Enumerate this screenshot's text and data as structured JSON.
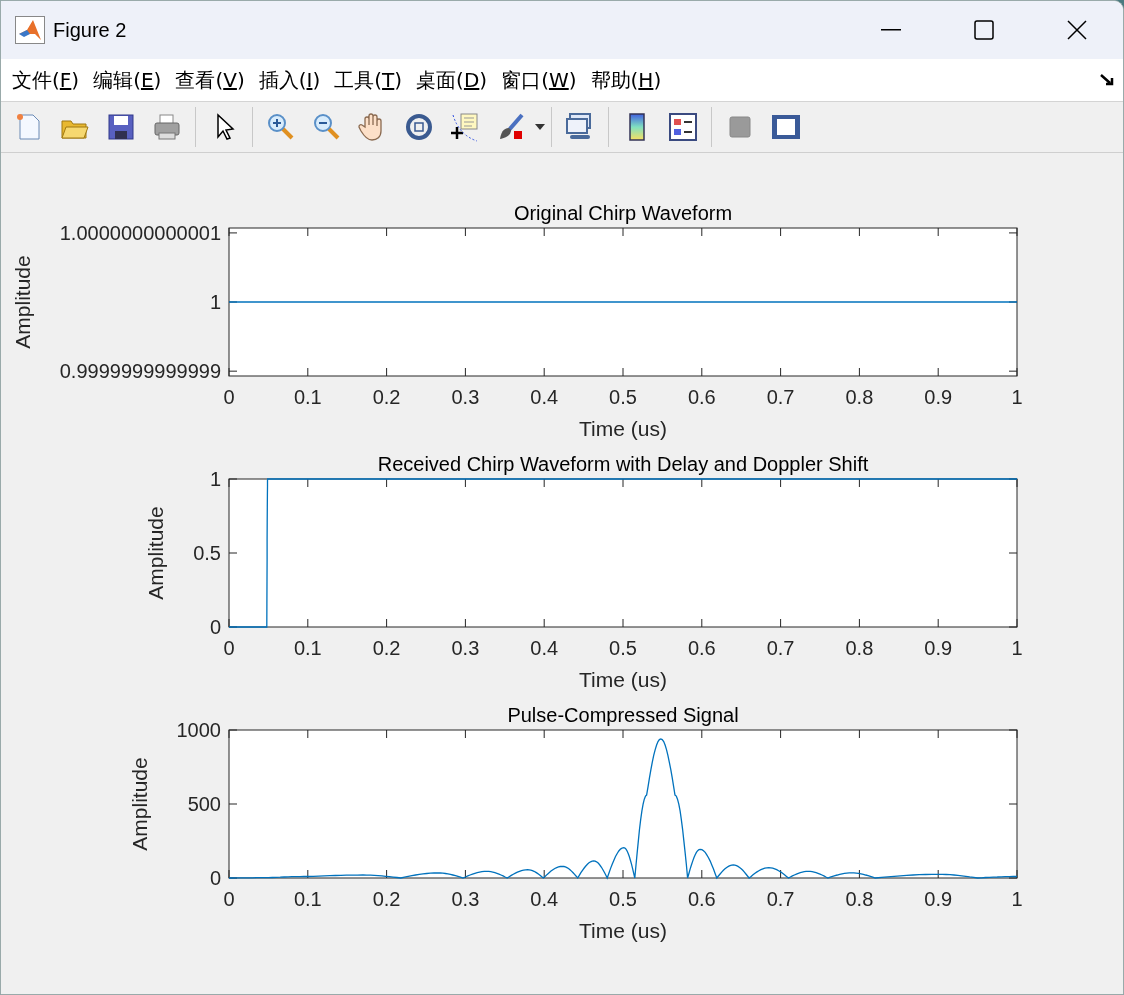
{
  "window": {
    "title": "Figure 2"
  },
  "menu": [
    {
      "text": "文件(",
      "accel": "F",
      "end": ")"
    },
    {
      "text": "编辑(",
      "accel": "E",
      "end": ")"
    },
    {
      "text": "查看(",
      "accel": "V",
      "end": ")"
    },
    {
      "text": "插入(",
      "accel": "I",
      "end": ")"
    },
    {
      "text": "工具(",
      "accel": "T",
      "end": ")"
    },
    {
      "text": "桌面(",
      "accel": "D",
      "end": ")"
    },
    {
      "text": "窗口(",
      "accel": "W",
      "end": ")"
    },
    {
      "text": "帮助(",
      "accel": "H",
      "end": ")"
    }
  ],
  "figure": {
    "axes": [
      {
        "chart_data": {
          "type": "line",
          "title": "Original Chirp Waveform",
          "xlabel": "Time (us)",
          "ylabel": "Amplitude",
          "x": [
            0,
            1
          ],
          "series": [
            {
              "color": "#0072bd",
              "values": [
                1,
                1
              ]
            }
          ],
          "xlim": [
            0,
            1
          ],
          "ylim": [
            0.999999999999893,
            1.000000000000107
          ],
          "xticks": [
            0,
            0.1,
            0.2,
            0.3,
            0.4,
            0.5,
            0.6,
            0.7,
            0.8,
            0.9,
            1
          ],
          "yticks": [
            {
              "value": 0.9999999999999,
              "label": "0.9999999999999"
            },
            {
              "value": 1,
              "label": "1"
            },
            {
              "value": 1.0000000000001,
              "label": "1.0000000000001"
            }
          ]
        }
      },
      {
        "chart_data": {
          "type": "line",
          "title": "Received Chirp Waveform with Delay and Doppler Shift",
          "xlabel": "Time (us)",
          "ylabel": "Amplitude",
          "x": [
            0,
            0.048,
            0.049,
            1
          ],
          "series": [
            {
              "color": "#0072bd",
              "values": [
                0,
                0,
                1,
                1
              ]
            }
          ],
          "xlim": [
            0,
            1
          ],
          "ylim": [
            0,
            1
          ],
          "xticks": [
            0,
            0.1,
            0.2,
            0.3,
            0.4,
            0.5,
            0.6,
            0.7,
            0.8,
            0.9,
            1
          ],
          "yticks": [
            0,
            0.5,
            1
          ]
        }
      },
      {
        "chart_data": {
          "type": "line",
          "title": "Pulse-Compressed Signal",
          "xlabel": "Time (us)",
          "ylabel": "Amplitude",
          "x": [
            0,
            0.05,
            0.1,
            0.17,
            0.218,
            0.265,
            0.297,
            0.327,
            0.353,
            0.379,
            0.399,
            0.423,
            0.4425,
            0.463,
            0.48,
            0.501,
            0.515,
            0.53,
            0.548,
            0.566,
            0.582,
            0.598,
            0.619,
            0.64,
            0.66,
            0.685,
            0.71,
            0.735,
            0.76,
            0.79,
            0.82,
            0.9,
            0.95,
            1
          ],
          "series": [
            {
              "color": "#0072bd",
              "values": [
                0,
                2,
                10,
                20,
                0,
                34,
                0,
                45,
                0,
                56,
                0,
                79,
                0,
                115,
                0,
                205,
                0,
                560,
                940,
                560,
                0,
                194,
                0,
                88,
                0,
                70,
                0,
                45,
                0,
                35,
                0,
                25,
                0,
                10
              ]
            }
          ],
          "xlim": [
            0,
            1
          ],
          "ylim": [
            0,
            1000
          ],
          "xticks": [
            0,
            0.1,
            0.2,
            0.3,
            0.4,
            0.5,
            0.6,
            0.7,
            0.8,
            0.9,
            1
          ],
          "yticks": [
            0,
            500,
            1000
          ]
        }
      }
    ]
  }
}
